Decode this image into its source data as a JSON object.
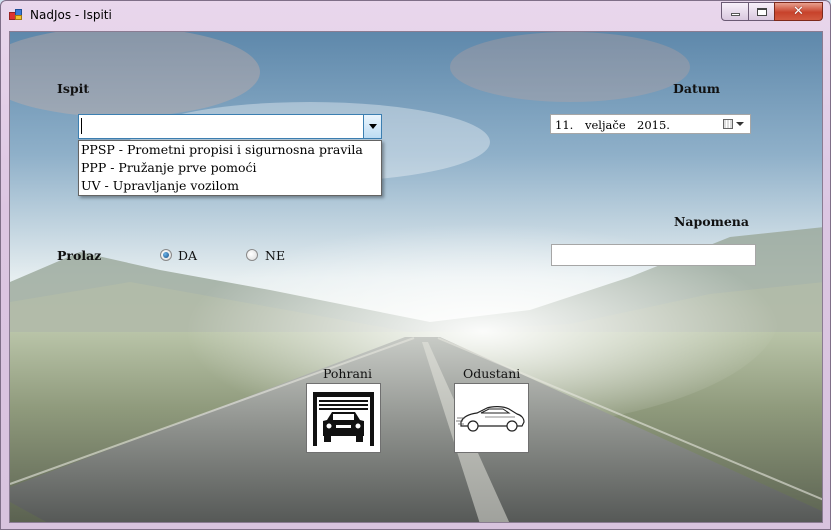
{
  "window": {
    "title": "NadJos - Ispiti",
    "minimize_icon": "minimize-icon",
    "maximize_icon": "maximize-icon",
    "close_icon": "close-icon",
    "close_glyph": "✕"
  },
  "form": {
    "ispit_label": "Ispit",
    "ispit_value": "",
    "ispit_options": [
      "PPSP - Prometni propisi i sigurnosna pravila",
      "PPP - Pružanje prve pomoći",
      "UV - Upravljanje vozilom"
    ],
    "datum_label": "Datum",
    "date": {
      "day": "11.",
      "month": "veljače",
      "year": "2015."
    },
    "napomena_label": "Napomena",
    "napomena_value": "",
    "prolaz_label": "Prolaz",
    "radio_da": {
      "label": "DA",
      "checked": true
    },
    "radio_ne": {
      "label": "NE",
      "checked": false
    },
    "pohrani_label": "Pohrani",
    "pohrani_icon": "garage-car-icon",
    "odustani_label": "Odustani",
    "odustani_icon": "sports-car-icon"
  },
  "colors": {
    "combo_border": "#3c7fb1",
    "close_button": "#c7422b",
    "window_frame": "#dcc6e2"
  }
}
